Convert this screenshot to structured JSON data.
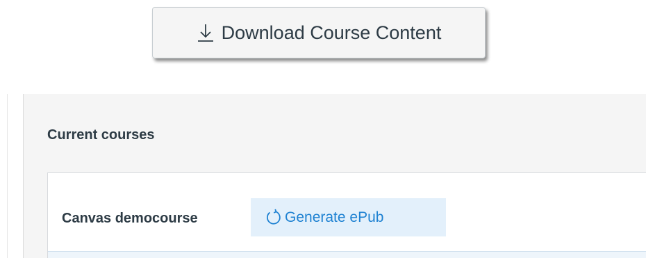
{
  "download": {
    "label": "Download Course Content",
    "icon": "download-icon"
  },
  "courses": {
    "title": "Current courses",
    "items": [
      {
        "name": "Canvas democourse",
        "action_label": "Generate ePub",
        "action_icon": "refresh-icon"
      }
    ]
  },
  "colors": {
    "text": "#2d3b45",
    "link": "#1f82d2",
    "action_bg": "#e3f0fb",
    "panel_bg": "#f5f5f5"
  }
}
